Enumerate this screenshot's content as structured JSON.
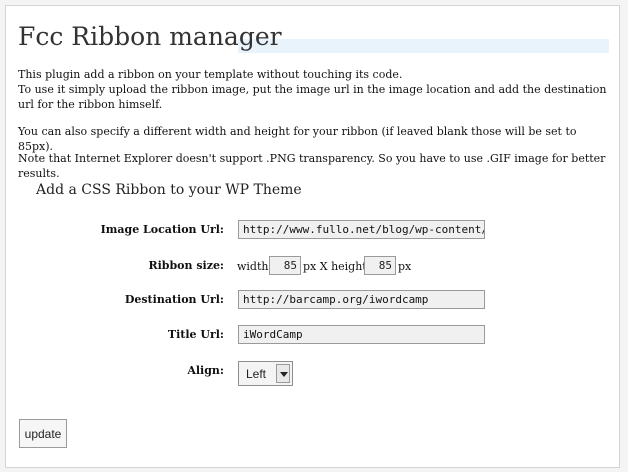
{
  "page": {
    "title": "Fcc Ribbon manager",
    "intro": [
      "This plugin add a ribbon on your template without touching its code.",
      "To use it simply upload the ribbon image, put the image url in the image location and add the destination url for the ribbon himself.",
      "You can also specify a different width and height for your ribbon (if leaved blank those will be set to 85px).",
      "Note that Internet Explorer doesn't support .PNG transparency. So you have to use .GIF image for better results."
    ]
  },
  "form": {
    "heading": "Add a CSS Ribbon to your WP Theme",
    "image_location": {
      "label": "Image Location Url:",
      "value": "http://www.fullo.net/blog/wp-content/upl"
    },
    "ribbon_size": {
      "label": "Ribbon size:",
      "width_label": "width:",
      "width_value": "85",
      "px_x_height": "px X height:",
      "height_value": "85",
      "px": "px"
    },
    "destination": {
      "label": "Destination Url:",
      "value": "http://barcamp.org/iwordcamp"
    },
    "title": {
      "label": "Title Url:",
      "value": "iWordCamp"
    },
    "align": {
      "label": "Align:",
      "value": "Left"
    },
    "submit_label": "update"
  },
  "colors": {
    "title_band": "#e9f3fc",
    "background": "#f4f4f4"
  }
}
